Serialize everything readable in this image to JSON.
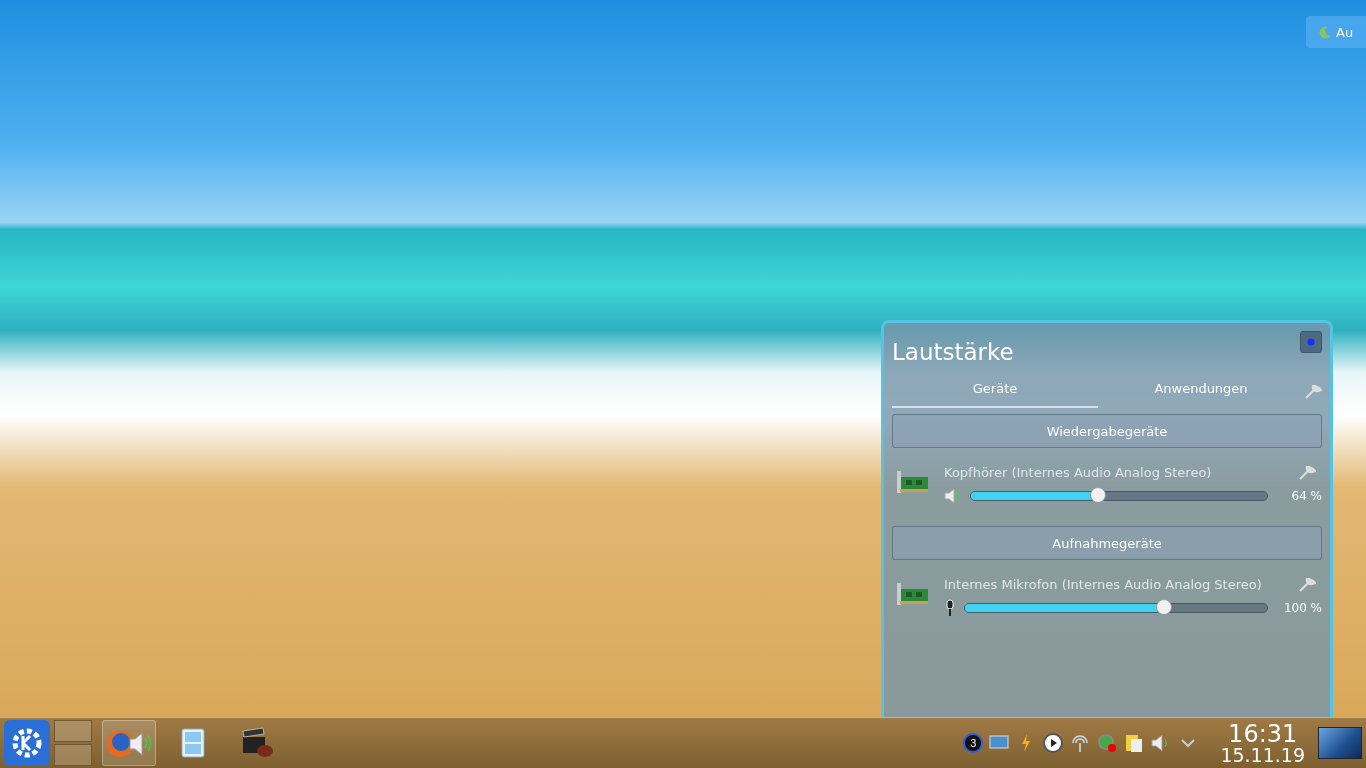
{
  "notification": {
    "text": "Au"
  },
  "popup": {
    "title": "Lautstärke",
    "tabs": [
      {
        "label": "Geräte",
        "selected": true
      },
      {
        "label": "Anwendungen",
        "selected": false
      }
    ],
    "sections": [
      {
        "heading": "Wiedergabegeräte",
        "devices": [
          {
            "name": "Kopfhörer (Internes Audio Analog Stereo)",
            "kind": "speaker",
            "level": 0.43,
            "reading": "64 %"
          }
        ]
      },
      {
        "heading": "Aufnahmegeräte",
        "devices": [
          {
            "name": "Internes Mikrofon (Internes Audio Analog Stereo)",
            "kind": "microphone",
            "level": 0.66,
            "reading": "100 %"
          }
        ]
      }
    ]
  },
  "taskbar": {
    "tasks": [
      {
        "kind": "browser",
        "selected": true
      },
      {
        "kind": "files",
        "selected": false
      },
      {
        "kind": "video",
        "selected": false
      }
    ],
    "tray": {
      "badge": "3",
      "time": "16:31",
      "date": "15.11.19"
    }
  }
}
